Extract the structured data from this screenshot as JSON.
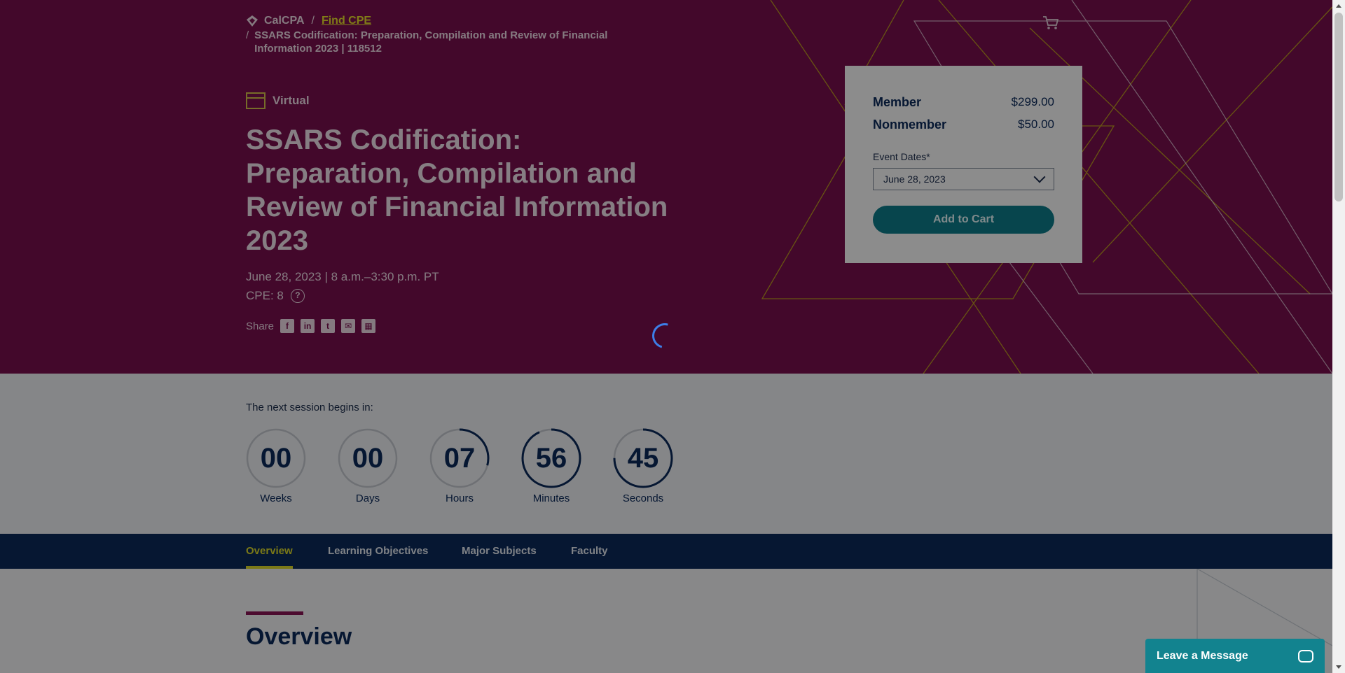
{
  "breadcrumb": {
    "home": "CalCPA",
    "separator": "/",
    "find_cpe": "Find CPE",
    "current": "SSARS Codification: Preparation, Compilation and Review of Financial Information 2023 | 118512"
  },
  "event": {
    "format": "Virtual",
    "title": "SSARS Codification: Preparation, Compilation and Review of Financial Information 2023",
    "date_time": "June 28, 2023 | 8 a.m.–3:30 p.m. PT",
    "cpe": "CPE: 8",
    "help_glyph": "?"
  },
  "share": {
    "label": "Share",
    "icons": [
      "facebook-icon",
      "linkedin-icon",
      "twitter-icon",
      "email-icon",
      "calendar-icon"
    ],
    "glyphs": [
      "f",
      "in",
      "t",
      "✉",
      "▦"
    ]
  },
  "pricing": {
    "member_label": "Member",
    "member_price": "$299.00",
    "nonmember_label": "Nonmember",
    "nonmember_price": "$50.00",
    "event_dates_label": "Event Dates*",
    "selected_date": "June 28, 2023",
    "add_to_cart": "Add to Cart"
  },
  "countdown": {
    "label": "The next session begins in:",
    "units": [
      {
        "value": "00",
        "name": "Weeks",
        "fraction": 0
      },
      {
        "value": "00",
        "name": "Days",
        "fraction": 0
      },
      {
        "value": "07",
        "name": "Hours",
        "fraction": 0.29
      },
      {
        "value": "56",
        "name": "Minutes",
        "fraction": 0.93
      },
      {
        "value": "45",
        "name": "Seconds",
        "fraction": 0.75
      }
    ]
  },
  "tabs": [
    {
      "label": "Overview",
      "active": true
    },
    {
      "label": "Learning Objectives",
      "active": false
    },
    {
      "label": "Major Subjects",
      "active": false
    },
    {
      "label": "Faculty",
      "active": false
    }
  ],
  "overview": {
    "heading": "Overview"
  },
  "chat": {
    "label": "Leave a Message"
  },
  "colors": {
    "hero": "#7a0f4f",
    "navy": "#0b2a5c",
    "accent_yellow": "#e0dc2b",
    "teal": "#0d7e8c"
  }
}
